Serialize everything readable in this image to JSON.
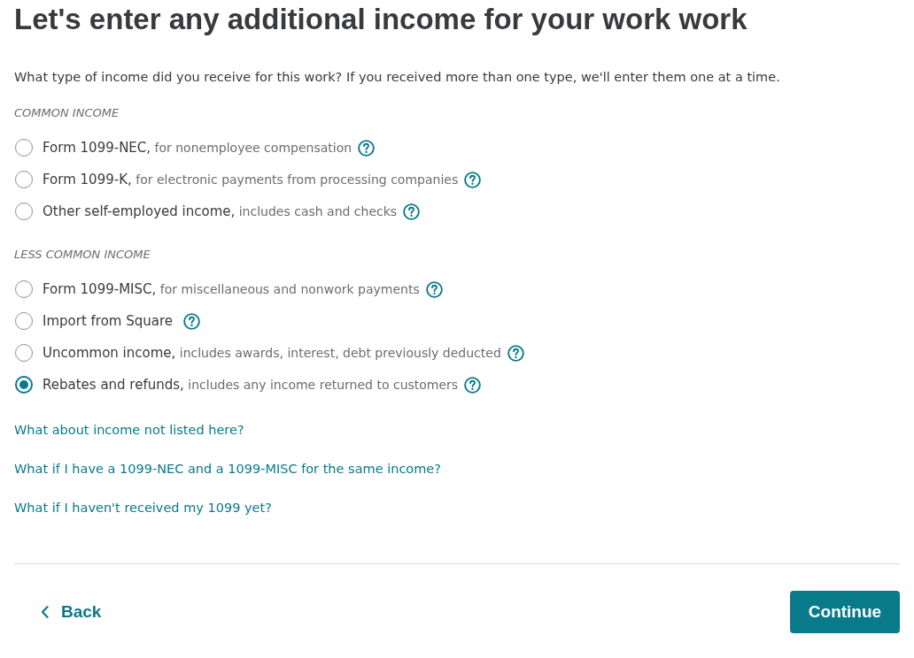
{
  "heading": "Let's enter any additional income for your work work",
  "prompt": "What type of income did you receive for this work? If you received more than one type, we'll enter them one at a time.",
  "groups": [
    {
      "label": "COMMON INCOME",
      "options": [
        {
          "title": "Form 1099-NEC,",
          "description": "for nonemployee compensation",
          "selected": false
        },
        {
          "title": "Form 1099-K,",
          "description": "for electronic payments from processing companies",
          "selected": false
        },
        {
          "title": "Other self-employed income,",
          "description": "includes cash and checks",
          "selected": false
        }
      ]
    },
    {
      "label": "LESS COMMON INCOME",
      "options": [
        {
          "title": "Form 1099-MISC,",
          "description": "for miscellaneous and nonwork payments",
          "selected": false
        },
        {
          "title": "Import from Square",
          "selected": false
        },
        {
          "title": "Uncommon income,",
          "description": "includes awards, interest, debt previously deducted",
          "selected": false
        },
        {
          "title": "Rebates and refunds,",
          "description": "includes any income returned to customers",
          "selected": true
        }
      ]
    }
  ],
  "help_links": [
    "What about income not listed here?",
    "What if I have a 1099-NEC and a 1099-MISC for the same income?",
    "What if I haven't received my 1099 yet?"
  ],
  "footer": {
    "back": "Back",
    "continue": "Continue"
  }
}
